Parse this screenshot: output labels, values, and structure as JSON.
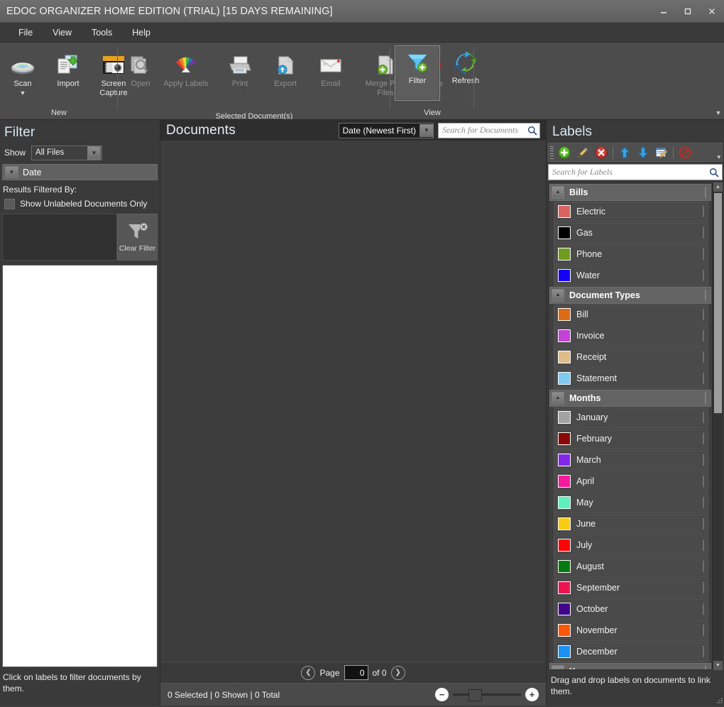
{
  "window": {
    "title": "EDOC ORGANIZER HOME EDITION (TRIAL) [15 DAYS REMAINING]",
    "minimize_label": "Minimize",
    "maximize_label": "Maximize",
    "close_label": "Close"
  },
  "menu": {
    "items": [
      {
        "label": "File"
      },
      {
        "label": "View"
      },
      {
        "label": "Tools"
      },
      {
        "label": "Help"
      }
    ]
  },
  "ribbon": {
    "groups": [
      {
        "name": "New",
        "label": "New",
        "buttons": [
          {
            "label": "Scan",
            "icon": "scanner-icon",
            "enabled": true,
            "dropdown": true
          },
          {
            "label": "Import",
            "icon": "import-document-icon",
            "enabled": true
          },
          {
            "label": "Screen Capture",
            "icon": "camera-icon",
            "enabled": true
          }
        ]
      },
      {
        "name": "Selected Document(s)",
        "label": "Selected Document(s)",
        "buttons": [
          {
            "label": "Open",
            "icon": "open-document-icon",
            "enabled": false
          },
          {
            "label": "Apply Labels",
            "icon": "color-fan-icon",
            "enabled": false
          },
          {
            "label": "Print",
            "icon": "printer-icon",
            "enabled": false
          },
          {
            "label": "Export",
            "icon": "export-icon",
            "enabled": false
          },
          {
            "label": "Email",
            "icon": "envelope-icon",
            "enabled": false
          },
          {
            "label": "Merge PDF Files",
            "icon": "merge-pdf-icon",
            "enabled": false
          },
          {
            "label": "Delete",
            "icon": "delete-circle-icon",
            "enabled": false
          }
        ]
      },
      {
        "name": "View",
        "label": "View",
        "buttons": [
          {
            "label": "Filter",
            "icon": "funnel-add-icon",
            "enabled": true,
            "active": true
          },
          {
            "label": "Refresh",
            "icon": "refresh-arrows-icon",
            "enabled": true
          }
        ]
      }
    ],
    "overflow_icon": "chevron-down-icon"
  },
  "filter_panel": {
    "title": "Filter",
    "show_label": "Show",
    "show_value": "All Files",
    "show_options": [
      "All Files"
    ],
    "date_section_label": "Date",
    "results_filtered_by_label": "Results Filtered By:",
    "unlabeled_checkbox_label": "Show Unlabeled Documents Only",
    "unlabeled_checked": false,
    "clear_filter_label": "Clear Filter",
    "clear_filter_icon": "funnel-clear-icon",
    "hint": "Click on labels to filter documents by them."
  },
  "documents_panel": {
    "title": "Documents",
    "sort_value": "Date (Newest First)",
    "sort_options": [
      "Date (Newest First)"
    ],
    "search_placeholder": "Search for Documents",
    "search_value": "",
    "search_icon": "search-icon",
    "pager": {
      "prev_icon": "arrow-left-circle-icon",
      "next_icon": "arrow-right-circle-icon",
      "page_label": "Page",
      "page_value": "0",
      "of_label": "of 0"
    },
    "status_text": "0 Selected | 0 Shown | 0 Total",
    "zoom_out_icon": "minus-circle-icon",
    "zoom_in_icon": "plus-circle-icon",
    "zoom_value": 28
  },
  "labels_panel": {
    "title": "Labels",
    "toolbar": [
      {
        "name": "add-label-button",
        "icon": "plus-circle-green-icon",
        "label": "Add Label"
      },
      {
        "name": "edit-label-button",
        "icon": "pencil-icon",
        "label": "Edit Label"
      },
      {
        "name": "delete-label-button",
        "icon": "delete-circle-red-icon",
        "label": "Delete Label"
      },
      {
        "name": "move-up-button",
        "icon": "arrow-up-blue-icon",
        "label": "Move Up"
      },
      {
        "name": "move-down-button",
        "icon": "arrow-down-blue-icon",
        "label": "Move Down"
      },
      {
        "name": "edit-properties-button",
        "icon": "note-pencil-icon",
        "label": "Edit Properties"
      },
      {
        "name": "clear-selection-button",
        "icon": "no-entry-icon",
        "label": "Clear Selection"
      }
    ],
    "search_placeholder": "Search for Labels",
    "search_value": "",
    "search_icon": "search-icon",
    "hint": "Drag and drop labels on documents to link them.",
    "groups": [
      {
        "name": "Bills",
        "expanded": true,
        "checked": false,
        "labels": [
          {
            "name": "Electric",
            "color": "#d9635f",
            "checked": false
          },
          {
            "name": "Gas",
            "color": "#000000",
            "checked": false
          },
          {
            "name": "Phone",
            "color": "#6f9b1f",
            "checked": false
          },
          {
            "name": "Water",
            "color": "#1400f5",
            "checked": false
          }
        ]
      },
      {
        "name": "Document Types",
        "expanded": true,
        "checked": false,
        "labels": [
          {
            "name": "Bill",
            "color": "#dd6a15",
            "checked": false
          },
          {
            "name": "Invoice",
            "color": "#c641d8",
            "checked": false
          },
          {
            "name": "Receipt",
            "color": "#e0bc8a",
            "checked": false
          },
          {
            "name": "Statement",
            "color": "#7fcbf0",
            "checked": false
          }
        ]
      },
      {
        "name": "Months",
        "expanded": true,
        "checked": false,
        "labels": [
          {
            "name": "January",
            "color": "#a3a3a3",
            "checked": false
          },
          {
            "name": "February",
            "color": "#8a0707",
            "checked": false
          },
          {
            "name": "March",
            "color": "#8227e8",
            "checked": false
          },
          {
            "name": "April",
            "color": "#f71a9c",
            "checked": false
          },
          {
            "name": "May",
            "color": "#5cf0bd",
            "checked": false
          },
          {
            "name": "June",
            "color": "#f8cb10",
            "checked": false
          },
          {
            "name": "July",
            "color": "#fa0505",
            "checked": false
          },
          {
            "name": "August",
            "color": "#047a10",
            "checked": false
          },
          {
            "name": "September",
            "color": "#ef1250",
            "checked": false
          },
          {
            "name": "October",
            "color": "#43038f",
            "checked": false
          },
          {
            "name": "November",
            "color": "#fa5907",
            "checked": false
          },
          {
            "name": "December",
            "color": "#1b92f2",
            "checked": false
          }
        ]
      },
      {
        "name": "Years",
        "expanded": true,
        "checked": false,
        "labels": []
      }
    ]
  }
}
